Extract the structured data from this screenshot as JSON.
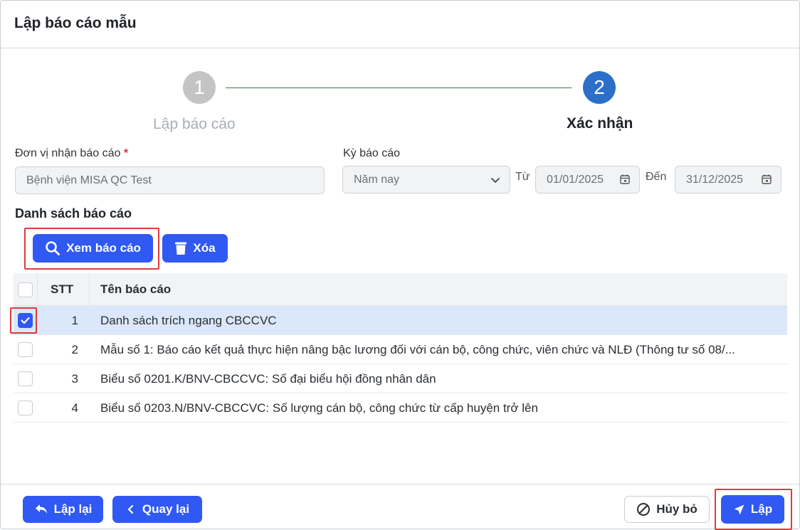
{
  "dialog": {
    "title": "Lập báo cáo mẫu"
  },
  "stepper": {
    "steps": [
      {
        "number": "1",
        "label": "Lập báo cáo"
      },
      {
        "number": "2",
        "label": "Xác nhận"
      }
    ]
  },
  "form": {
    "unit_label": "Đơn vị nhận báo cáo",
    "required_mark": "*",
    "unit_value": "Bệnh viện MISA QC Test",
    "period_label": "Kỳ báo cáo",
    "period_value": "Năm nay",
    "from_label": "Từ",
    "from_value": "01/01/2025",
    "to_label": "Đến",
    "to_value": "31/12/2025"
  },
  "list": {
    "title": "Danh sách báo cáo",
    "view_button": "Xem báo cáo",
    "delete_button": "Xóa",
    "columns": {
      "stt": "STT",
      "name": "Tên báo cáo"
    },
    "rows": [
      {
        "stt": "1",
        "name": "Danh sách trích ngang CBCCVC",
        "checked": true
      },
      {
        "stt": "2",
        "name": "Mẫu số 1: Báo cáo kết quả thực hiện nâng bậc lương đối với cán bộ, công chức, viên chức và NLĐ (Thông tư số 08/...",
        "checked": false
      },
      {
        "stt": "3",
        "name": "Biểu số 0201.K/BNV-CBCCVC: Số đại biểu hội đồng nhân dân",
        "checked": false
      },
      {
        "stt": "4",
        "name": "Biểu số 0203.N/BNV-CBCCVC: Số lượng cán bộ, công chức từ cấp huyện trở lên",
        "checked": false
      }
    ]
  },
  "footer": {
    "reset_button": "Lập lại",
    "back_button": "Quay lại",
    "cancel_button": "Hủy bỏ",
    "submit_button": "Lập"
  },
  "colors": {
    "primary": "#3058f2",
    "step_active": "#2b6fc9",
    "step_inactive": "#c4c4c4",
    "selected_row": "#dbe8fb",
    "highlight": "#e03a3a"
  }
}
